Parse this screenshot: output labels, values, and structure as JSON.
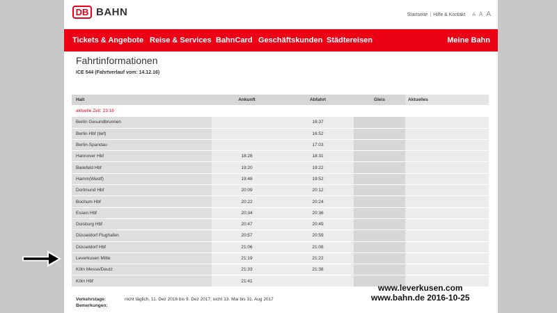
{
  "header": {
    "logo_db": "DB",
    "logo_text": "BAHN",
    "links": [
      "Startseite",
      "Hilfe & Kontakt"
    ],
    "font_sizes": [
      "A",
      "A",
      "A"
    ]
  },
  "nav": {
    "items": [
      "Tickets & Angebote",
      "Reise & Services",
      "BahnCard",
      "Geschäftskunden",
      "Städtereisen"
    ],
    "right": "Meine Bahn"
  },
  "page": {
    "title": "Fahrtinformationen",
    "subtitle": "ICE 544 (Fahrtverlauf vom: 14.12.16)"
  },
  "table": {
    "headers": {
      "halt": "Halt",
      "ankunft": "Ankunft",
      "abfahrt": "Abfahrt",
      "gleis": "Gleis",
      "aktuelles": "Aktuelles"
    },
    "current_time": "aktuelle Zeit: 23:16",
    "rows": [
      {
        "halt": "Berlin Gesundbrunnen",
        "ankunft": "",
        "abfahrt": "16:37"
      },
      {
        "halt": "Berlin Hbf (tief)",
        "ankunft": "",
        "abfahrt": "16:52"
      },
      {
        "halt": "Berlin-Spandau",
        "ankunft": "",
        "abfahrt": "17:03"
      },
      {
        "halt": "Hannover Hbf",
        "ankunft": "18:28",
        "abfahrt": "18:31"
      },
      {
        "halt": "Bielefeld Hbf",
        "ankunft": "19:20",
        "abfahrt": "19:22"
      },
      {
        "halt": "Hamm(Westf)",
        "ankunft": "19:48",
        "abfahrt": "19:52"
      },
      {
        "halt": "Dortmund Hbf",
        "ankunft": "20:09",
        "abfahrt": "20:12"
      },
      {
        "halt": "Bochum Hbf",
        "ankunft": "20:22",
        "abfahrt": "20:24"
      },
      {
        "halt": "Essen Hbf",
        "ankunft": "20:34",
        "abfahrt": "20:36"
      },
      {
        "halt": "Duisburg Hbf",
        "ankunft": "20:47",
        "abfahrt": "20:49"
      },
      {
        "halt": "Düsseldorf Flughafen",
        "ankunft": "20:57",
        "abfahrt": "20:59"
      },
      {
        "halt": "Düsseldorf Hbf",
        "ankunft": "21:06",
        "abfahrt": "21:08"
      },
      {
        "halt": "Leverkusen Mitte",
        "ankunft": "21:19",
        "abfahrt": "21:22"
      },
      {
        "halt": "Köln Messe/Deutz",
        "ankunft": "21:33",
        "abfahrt": "21:38"
      },
      {
        "halt": "Köln Hbf",
        "ankunft": "21:41",
        "abfahrt": ""
      }
    ]
  },
  "footer": {
    "verkehrstage_label": "Verkehrstage:",
    "verkehrstage_value": "nicht täglich, 11. Dez 2016 bis 9. Dez 2017; nicht 13. Mai bis 31. Aug 2017",
    "bemerkungen_label": "Bemerkungen:"
  },
  "watermark": {
    "line1": "www.leverkusen.com",
    "line2": "www.bahn.de 2016-10-25"
  },
  "colors": {
    "brand_red": "#ec0016",
    "background_gray": "#c8c8c8"
  }
}
